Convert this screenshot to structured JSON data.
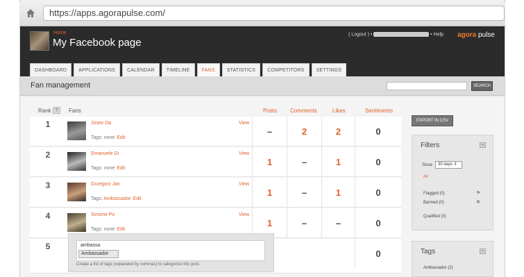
{
  "browser": {
    "url": "https://apps.agorapulse.com/"
  },
  "header": {
    "crumb": "Home",
    "title": "My Facebook page",
    "logout": "( Logout )",
    "help": "• Help",
    "brand_a": "agora",
    "brand_b": "pulse"
  },
  "tabs": [
    "DASHBOARD",
    "APPLICATIONS",
    "CALENDAR",
    "TIMELINE",
    "FANS",
    "STATISTICS",
    "COMPETITORS",
    "SETTINGS"
  ],
  "active_tab": "FANS",
  "section": {
    "title": "Fan management",
    "search_label": "SEARCH"
  },
  "columns": {
    "rank": "Rank",
    "rank_help": "?",
    "fans": "Fans",
    "posts": "Posts",
    "comments": "Comments",
    "likes": "Likes",
    "sentiments": "Sentiments"
  },
  "rows": [
    {
      "rank": "1",
      "name": "Josex Da",
      "view": "View",
      "tags_label": "Tags:",
      "tags": "none",
      "edit": "Edit",
      "posts": "–",
      "comments": "2",
      "likes": "2",
      "sentiments": "0"
    },
    {
      "rank": "2",
      "name": "Emanuele Di",
      "view": "View",
      "tags_label": "Tags:",
      "tags": "none",
      "edit": "Edit",
      "posts": "1",
      "comments": "–",
      "likes": "1",
      "sentiments": "0"
    },
    {
      "rank": "3",
      "name": "Grzegorz Jan",
      "view": "View",
      "tags_label": "Tags:",
      "tags": "Ambassador",
      "edit": "Edit",
      "posts": "1",
      "comments": "–",
      "likes": "1",
      "sentiments": "0"
    },
    {
      "rank": "4",
      "name": "Simone Po",
      "view": "View",
      "tags_label": "Tags:",
      "tags": "none",
      "edit": "Edit",
      "posts": "1",
      "comments": "–",
      "likes": "–",
      "sentiments": "0"
    },
    {
      "rank": "5",
      "name": "",
      "view": "",
      "tags_label": "",
      "tags": "",
      "edit": "",
      "posts": "",
      "comments": "",
      "likes": "",
      "sentiments": "0"
    }
  ],
  "tag_editor": {
    "value": "ambassa",
    "suggestion": "Ambassador",
    "help": "Create a list of tags (separated by commas) to categorize this post."
  },
  "sidebar": {
    "export_label": "EXPORT IN CSV",
    "filters": {
      "title": "Filters",
      "min": "–",
      "since_label": "Since",
      "since_value": "30 days ⇕",
      "all": "All",
      "flagged": "Flagged (0)",
      "banned": "Banned (0)",
      "qualified": "Qualified (0)"
    },
    "tags": {
      "title": "Tags",
      "min": "–",
      "item": "Ambassador (2)"
    }
  },
  "colors": {
    "accent": "#e0602a",
    "header_bg": "#2b2b2b"
  }
}
